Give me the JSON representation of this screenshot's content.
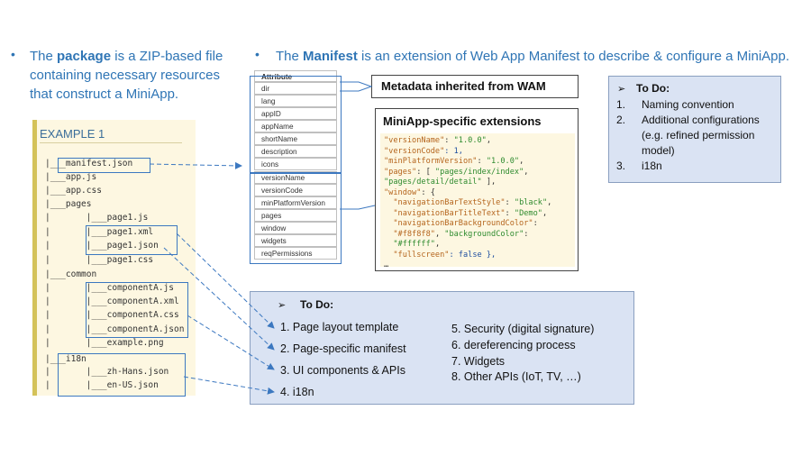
{
  "left_bullet": {
    "pre": "The ",
    "bold": "package",
    "line1_rest": " is a ZIP-based file",
    "line2": "containing necessary resources",
    "line3": "that construct a MiniApp."
  },
  "right_bullet": {
    "pre": "The ",
    "bold": "Manifest",
    "rest": " is an extension of Web App Manifest to describe & configure a MiniApp."
  },
  "example": {
    "title": "EXAMPLE 1",
    "lines": [
      "|___manifest.json",
      "|___app.js",
      "|___app.css",
      "|___pages",
      "|       |___page1.js",
      "|       |___page1.xml",
      "|       |___page1.json",
      "|       |___page1.css",
      "|___common",
      "|       |___componentA.js",
      "|       |___componentA.xml",
      "|       |___componentA.css",
      "|       |___componentA.json",
      "|       |___example.png",
      "|___i18n",
      "|       |___zh-Hans.json",
      "|       |___en-US.json"
    ]
  },
  "attributes": {
    "header": "Attribute",
    "inherited": [
      "dir",
      "lang",
      "appID",
      "appName",
      "shortName",
      "description",
      "icons"
    ],
    "extended": [
      "versionName",
      "versionCode",
      "minPlatformVersion",
      "pages",
      "window",
      "widgets",
      "reqPermissions"
    ]
  },
  "wam_callout": "Metadata inherited from WAM",
  "ext_callout": {
    "title": "MiniApp-specific extensions",
    "code": [
      "\"versionName\": \"1.0.0\",",
      "\"versionCode\": 1,",
      "\"minPlatformVersion\": \"1.0.0\",",
      "\"pages\": [ \"pages/index/index\",",
      "\"pages/detail/detail\" ],",
      "\"window\": {",
      "  \"navigationBarTextStyle\": \"black\",",
      "  \"navigationBarTitleText\": \"Demo\",",
      "  \"navigationBarBackgroundColor\":",
      "  \"#f8f8f8\", \"backgroundColor\":",
      "  \"#ffffff\",",
      "  \"fullscreen\": false },",
      "…"
    ]
  },
  "todo_top": {
    "heading": "To Do:",
    "items": [
      {
        "num": "1.",
        "text": "Naming convention"
      },
      {
        "num": "2.",
        "text": "Additional configurations"
      },
      {
        "num": "",
        "text": "(e.g. refined permission"
      },
      {
        "num": "",
        "text": "model)"
      },
      {
        "num": "3.",
        "text": "i18n"
      }
    ]
  },
  "todo_bottom": {
    "heading": "To Do:",
    "left_items": [
      "1. Page layout template",
      "2. Page-specific manifest",
      "3. UI components & APIs",
      "4. i18n"
    ],
    "right_items": [
      "5. Security (digital signature)",
      "6. dereferencing process",
      "7. Widgets",
      "8. Other APIs (IoT, TV, …)"
    ]
  },
  "colors": {
    "accent": "#2f75b5",
    "box_fill": "#dae3f3",
    "example_fill": "#fdf7e1",
    "arrow": "#3c78c0"
  },
  "icons": {
    "bullet": "bullet-dot-icon",
    "todo": "arrowhead-bullet-icon"
  }
}
